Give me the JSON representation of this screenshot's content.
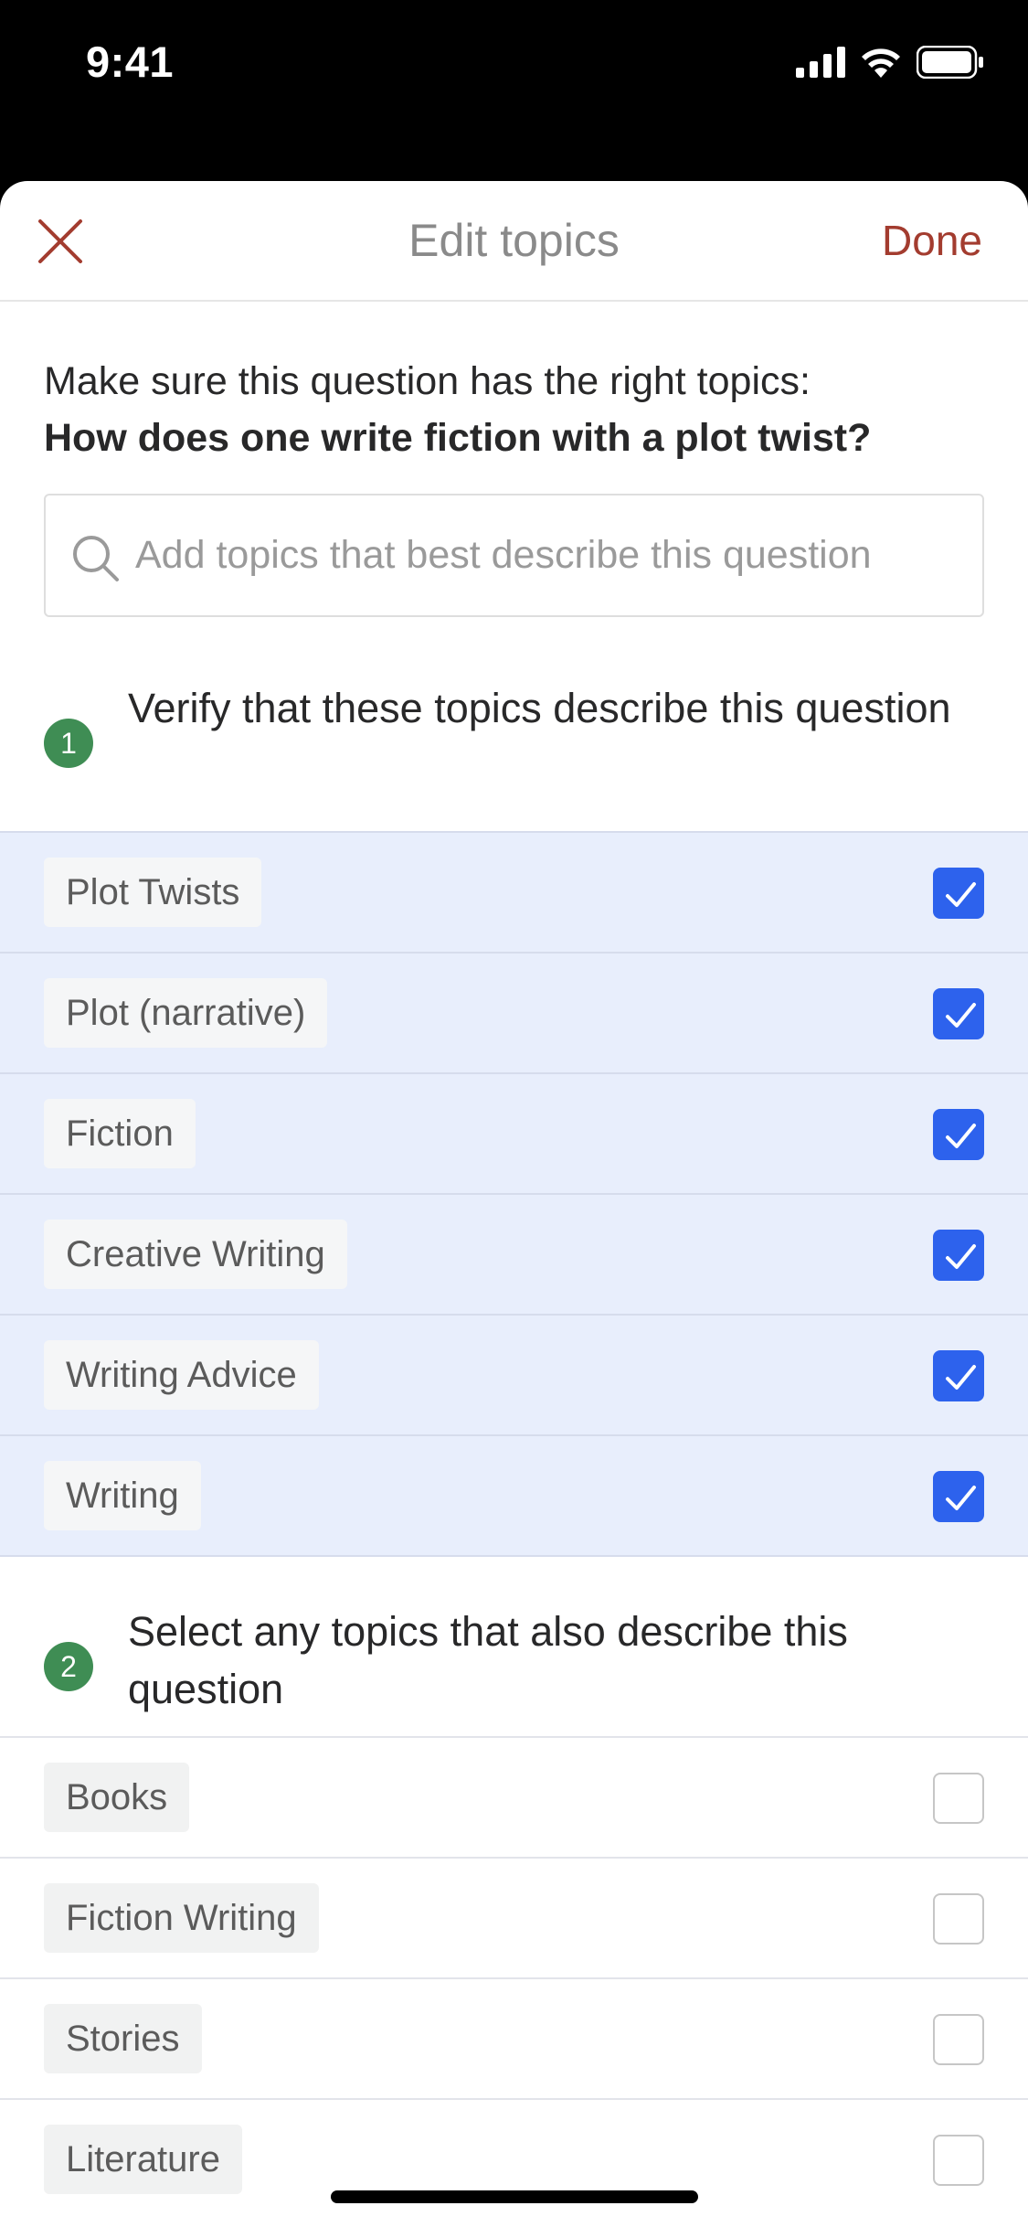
{
  "status_bar": {
    "time": "9:41",
    "icons": [
      "cellular-signal-icon",
      "wifi-icon",
      "battery-icon"
    ]
  },
  "nav": {
    "close_icon": "close-icon",
    "title": "Edit topics",
    "done_label": "Done"
  },
  "intro": {
    "line": "Make sure this question has the right topics:",
    "question": "How does one write fiction with a plot twist?"
  },
  "search": {
    "icon": "search-icon",
    "placeholder": "Add topics that best describe this question",
    "value": ""
  },
  "sections": [
    {
      "step": "1",
      "title": "Verify that these topics describe this question",
      "topics": [
        {
          "label": "Plot Twists",
          "checked": true
        },
        {
          "label": "Plot (narrative)",
          "checked": true
        },
        {
          "label": "Fiction",
          "checked": true
        },
        {
          "label": "Creative Writing",
          "checked": true
        },
        {
          "label": "Writing Advice",
          "checked": true
        },
        {
          "label": "Writing",
          "checked": true
        }
      ]
    },
    {
      "step": "2",
      "title": "Select any topics that also describe this question",
      "topics": [
        {
          "label": "Books",
          "checked": false
        },
        {
          "label": "Fiction Writing",
          "checked": false
        },
        {
          "label": "Stories",
          "checked": false
        },
        {
          "label": "Literature",
          "checked": false
        }
      ]
    }
  ],
  "colors": {
    "accent_done": "#a33c2f",
    "step_badge": "#3f8d54",
    "checkbox_checked": "#2d62ed",
    "checked_row_bg": "#e8eefc"
  }
}
